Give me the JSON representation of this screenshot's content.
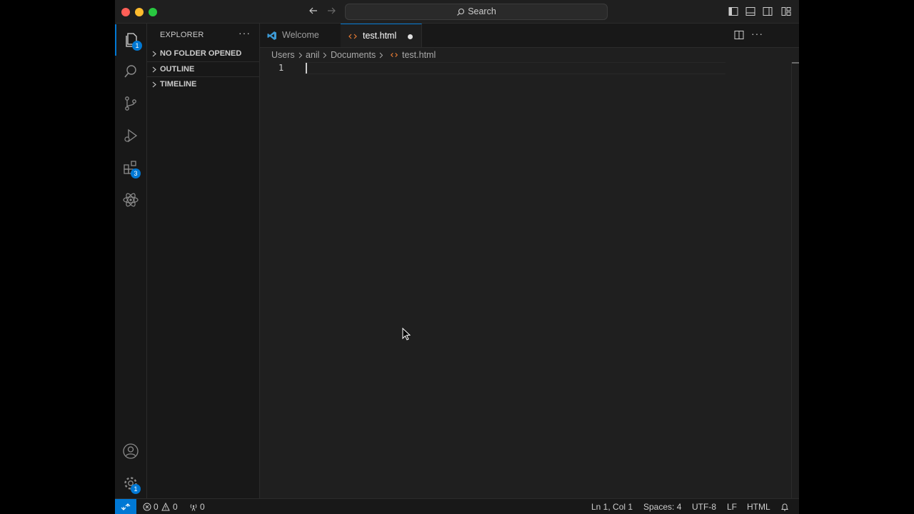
{
  "titlebar": {
    "search_label": "Search"
  },
  "activity_bar": {
    "explorer_badge": "1",
    "extensions_badge": "3",
    "manage_badge": "1"
  },
  "sidebar": {
    "title": "EXPLORER",
    "sections": [
      {
        "label": "NO FOLDER OPENED"
      },
      {
        "label": "OUTLINE"
      },
      {
        "label": "TIMELINE"
      }
    ]
  },
  "tabs": [
    {
      "label": "Welcome",
      "icon": "vscode-icon"
    },
    {
      "label": "test.html",
      "icon": "html-icon",
      "dirty": true
    }
  ],
  "breadcrumb": [
    "Users",
    "anil",
    "Documents",
    "test.html"
  ],
  "editor": {
    "line_numbers": [
      "1"
    ]
  },
  "statusbar": {
    "errors": "0",
    "warnings": "0",
    "ports": "0",
    "position": "Ln 1, Col 1",
    "indent": "Spaces: 4",
    "encoding": "UTF-8",
    "eol": "LF",
    "language": "HTML"
  },
  "colors": {
    "accent": "#0078d4",
    "html_icon": "#e37933",
    "vscode_icon": "#3c99d4"
  }
}
